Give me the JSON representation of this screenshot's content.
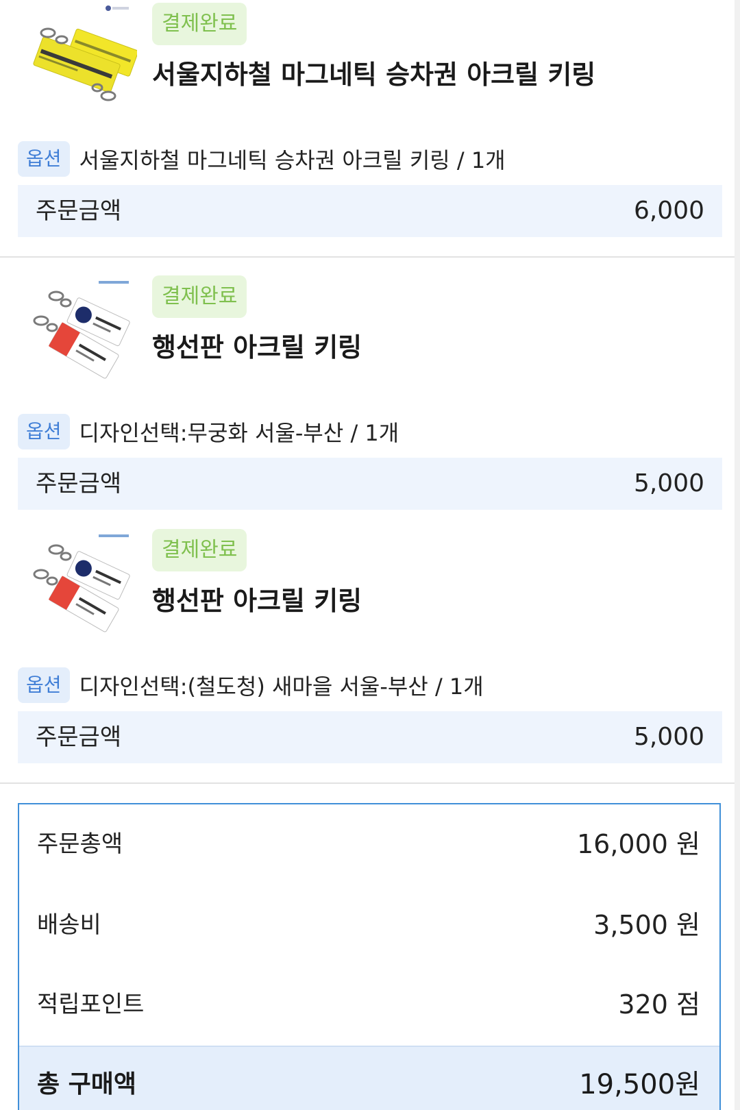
{
  "items": [
    {
      "status": "결제완료",
      "title": "서울지하철 마그네틱 승차권 아크릴 키링",
      "option_tag": "옵션",
      "option_text": "서울지하철 마그네틱 승차권 아크릴 키링 / 1개",
      "amount_label": "주문금액",
      "amount_value": "6,000",
      "thumb_icon": "yellow-ticket-keyring-image"
    },
    {
      "status": "결제완료",
      "title": "행선판 아크릴 키링",
      "option_tag": "옵션",
      "option_text": "디자인선택:무궁화 서울-부산 / 1개",
      "amount_label": "주문금액",
      "amount_value": "5,000",
      "thumb_icon": "destination-sign-keyring-image"
    },
    {
      "status": "결제완료",
      "title": "행선판 아크릴 키링",
      "option_tag": "옵션",
      "option_text": "디자인선택:(철도청) 새마을 서울-부산 / 1개",
      "amount_label": "주문금액",
      "amount_value": "5,000",
      "thumb_icon": "destination-sign-keyring-image"
    }
  ],
  "summary": {
    "order_total_label": "주문총액",
    "order_total_value": "16,000 원",
    "shipping_label": "배송비",
    "shipping_value": "3,500 원",
    "points_label": "적립포인트",
    "points_value": "320 점",
    "grand_total_label": "총 구매액",
    "grand_total_value": "19,500원"
  },
  "colors": {
    "badge_bg": "#e8f6dd",
    "badge_text": "#7fc04e",
    "option_tag_bg": "#e4eefb",
    "option_tag_text": "#3f7ed6",
    "amount_row_bg": "#eef4fd",
    "summary_border": "#3f8fd8"
  }
}
